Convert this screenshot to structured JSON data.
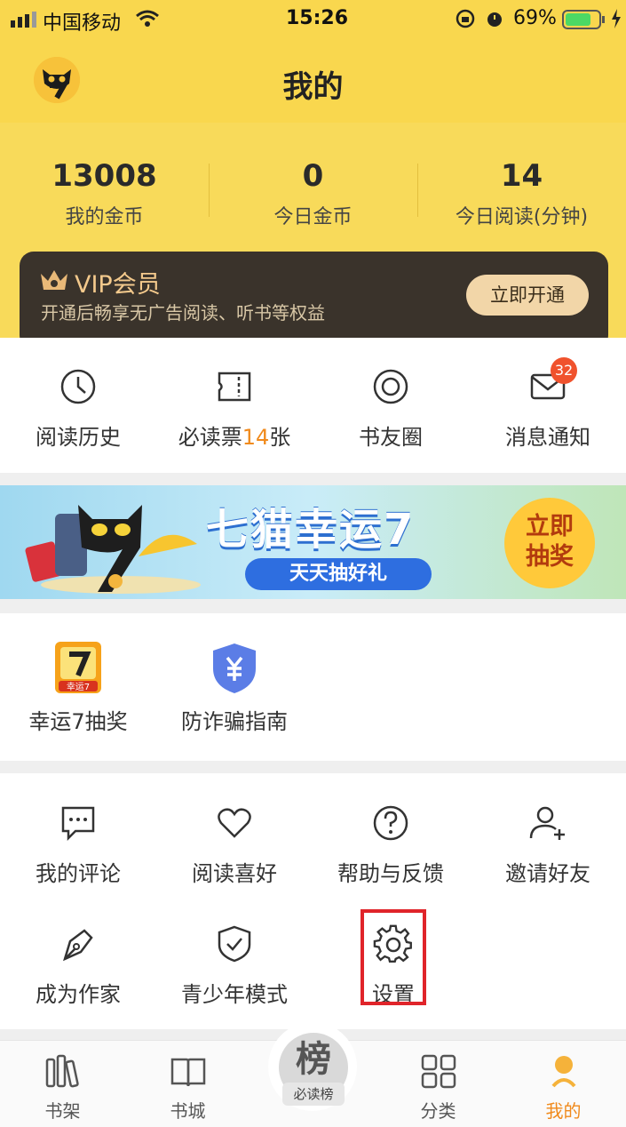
{
  "status_bar": {
    "carrier": "中国移动",
    "time": "15:26",
    "battery": "69%"
  },
  "header": {
    "title": "我的"
  },
  "stats": [
    {
      "value": "13008",
      "label": "我的金币"
    },
    {
      "value": "0",
      "label": "今日金币"
    },
    {
      "value": "14",
      "label": "今日阅读(分钟)"
    }
  ],
  "vip": {
    "title": "VIP会员",
    "subtitle": "开通后畅享无广告阅读、听书等权益",
    "button": "立即开通"
  },
  "quick": [
    {
      "label": "阅读历史",
      "icon": "clock-icon"
    },
    {
      "label_pre": "必读票",
      "label_num": "14",
      "label_post": "张",
      "icon": "ticket-icon"
    },
    {
      "label": "书友圈",
      "icon": "circle-icon"
    },
    {
      "label": "消息通知",
      "icon": "mail-icon",
      "badge": "32"
    }
  ],
  "banner": {
    "title": "七猫幸运7",
    "subtitle": "天天抽好礼",
    "button_line1": "立即",
    "button_line2": "抽奖"
  },
  "activities": [
    {
      "label": "幸运7抽奖",
      "icon": "lucky7-icon",
      "icon_text": "幸运7"
    },
    {
      "label": "防诈骗指南",
      "icon": "shield-yen-icon"
    }
  ],
  "tools": [
    {
      "label": "我的评论",
      "icon": "comment-icon"
    },
    {
      "label": "阅读喜好",
      "icon": "heart-icon"
    },
    {
      "label": "帮助与反馈",
      "icon": "help-icon"
    },
    {
      "label": "邀请好友",
      "icon": "add-user-icon"
    },
    {
      "label": "成为作家",
      "icon": "pen-icon"
    },
    {
      "label": "青少年模式",
      "icon": "shield-check-icon"
    },
    {
      "label": "设置",
      "icon": "gear-icon"
    }
  ],
  "tabbar": [
    {
      "label": "书架",
      "icon": "bookshelf-icon"
    },
    {
      "label": "书城",
      "icon": "book-icon"
    },
    {
      "label": "必读榜",
      "icon": "rank-icon",
      "icon_text": "榜"
    },
    {
      "label": "分类",
      "icon": "grid-icon"
    },
    {
      "label": "我的",
      "icon": "me-icon",
      "active": true
    }
  ],
  "colors": {
    "header_yellow": "#f9d74e",
    "accent_orange": "#f08a1c",
    "badge_red": "#f0522d",
    "highlight_red": "#e0242a"
  }
}
